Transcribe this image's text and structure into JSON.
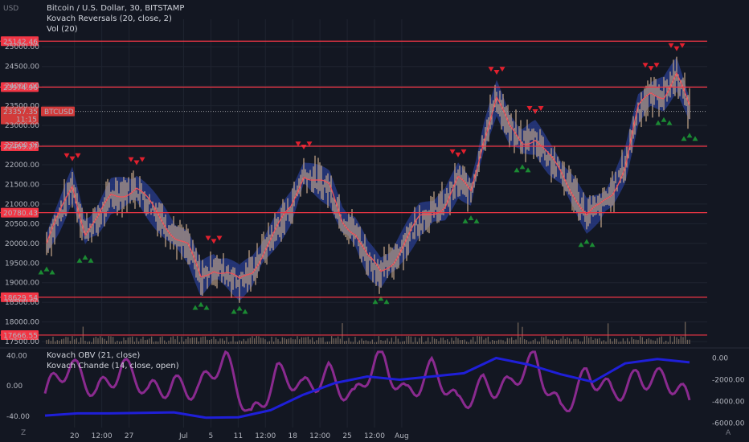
{
  "header": {
    "currency": "USD",
    "line1": "Bitcoin / U.S. Dollar, 30, BITSTAMP",
    "line2": "Kovach Reversals (20, close, 2)",
    "line3": "Vol (20)",
    "lower_line1": "Kovach OBV (21, close)",
    "lower_line2": "Kovach Chande (14, close, open)"
  },
  "price_tag": {
    "price": "23357.35",
    "countdown": "11:15",
    "symbol": "BTCUSD"
  },
  "corners": {
    "left": "Z",
    "right": "A"
  },
  "colors": {
    "background": "#131722",
    "level": "#f23645",
    "band": "#2a3e8f",
    "candle": "#c8a98a",
    "ma": "#e8545b",
    "up_marker": "#1b8a33",
    "down_marker": "#e1202e",
    "obv": "#1f1fd8",
    "chande": "#8a2a8f"
  },
  "chart_data": [
    {
      "type": "line",
      "title": "Bitcoin / U.S. Dollar, 30, BITSTAMP",
      "ylabel": "",
      "ylim": [
        17400,
        25700
      ],
      "y_ticks": [
        17500,
        18000,
        18500,
        19000,
        19500,
        20000,
        20500,
        21000,
        21500,
        22000,
        22500,
        23000,
        23500,
        24000,
        24500,
        25000
      ],
      "y_tick_labels": [
        "17500.00",
        "18000.00",
        "18500.00",
        "19000.00",
        "19500.00",
        "20000.00",
        "20500.00",
        "21000.00",
        "21500.00",
        "22000.00",
        "22500.00",
        "23000.00",
        "23500.00",
        "24000.00",
        "24500.00",
        "25000.00"
      ],
      "x_tick_labels": [
        "20",
        "12:00",
        "27",
        "Jul",
        "5",
        "11",
        "12:00",
        "18",
        "12:00",
        "25",
        "12:00",
        "Aug"
      ],
      "x_range_days": [
        19.4,
        31.6
      ],
      "x_tick_days": [
        20,
        20.5,
        21,
        22,
        22.5,
        23,
        23.5,
        24,
        24.5,
        25,
        25.5,
        26
      ],
      "x_tick_days_note": "",
      "levels": [
        {
          "value": 25142.46,
          "label": "25142.46"
        },
        {
          "value": 23974.96,
          "label": "23974.96"
        },
        {
          "value": 22469.27,
          "label": "22469.27"
        },
        {
          "value": 20780.43,
          "label": "20780.43"
        },
        {
          "value": 18629.54,
          "label": "18629.54"
        },
        {
          "value": 17666.55,
          "label": "17666.55"
        }
      ],
      "current_price": 23357.35,
      "series": [
        {
          "type": "line",
          "x": [
            0,
            0.02,
            0.04,
            0.06,
            0.08,
            0.1,
            0.12,
            0.14,
            0.16,
            0.18,
            0.2,
            0.22,
            0.24,
            0.26,
            0.28,
            0.3,
            0.32,
            0.34,
            0.36,
            0.38,
            0.4,
            0.42,
            0.44,
            0.46,
            0.48,
            0.5,
            0.52,
            0.54,
            0.56,
            0.58,
            0.6,
            0.62,
            0.64,
            0.66,
            0.68,
            0.7,
            0.72,
            0.74,
            0.76,
            0.78,
            0.8,
            0.82,
            0.84,
            0.86,
            0.88,
            0.9,
            0.92,
            0.94,
            0.96,
            0.98,
            1
          ],
          "values": [
            20000,
            20700,
            21500,
            20300,
            20600,
            21200,
            21300,
            21400,
            21000,
            20600,
            20200,
            19900,
            19100,
            19400,
            19250,
            19000,
            19300,
            19900,
            20400,
            20900,
            21800,
            21600,
            21400,
            20600,
            20300,
            19600,
            19250,
            19600,
            20100,
            20600,
            20800,
            21000,
            21600,
            21300,
            22700,
            23700,
            22900,
            22600,
            22700,
            22200,
            21800,
            21300,
            20700,
            20900,
            21300,
            22000,
            23400,
            23800,
            23800,
            24300,
            23400
          ]
        }
      ]
    },
    {
      "type": "line",
      "title": "Kovach OBV (21, close)",
      "ylim": [
        -6400,
        700
      ],
      "y_ticks": [
        0,
        -2000,
        -4000,
        -6000
      ],
      "y_tick_labels": [
        "0.00",
        "-2000.00",
        "-4000.00",
        "-6000.00"
      ],
      "series": [
        {
          "name": "Kovach OBV (21, close)",
          "x": [
            0,
            0.05,
            0.1,
            0.15,
            0.2,
            0.25,
            0.3,
            0.35,
            0.4,
            0.45,
            0.5,
            0.55,
            0.6,
            0.65,
            0.7,
            0.75,
            0.8,
            0.85,
            0.9,
            0.95,
            1
          ],
          "values": [
            -5300,
            -5100,
            -5100,
            -5050,
            -5000,
            -5500,
            -5450,
            -4800,
            -3400,
            -2300,
            -1700,
            -2000,
            -1700,
            -1400,
            0,
            -600,
            -1500,
            -2200,
            -500,
            -100,
            -400
          ]
        },
        {
          "name": "Kovach Chande (14, close, open)",
          "axis": "left",
          "ylim": [
            -55,
            47
          ],
          "y_ticks": [
            40,
            0,
            -40
          ],
          "y_tick_labels": [
            "40.00",
            "0.00",
            "-40.00"
          ],
          "x": [
            0,
            0.04,
            0.08,
            0.12,
            0.16,
            0.2,
            0.24,
            0.28,
            0.32,
            0.36,
            0.4,
            0.44,
            0.48,
            0.52,
            0.56,
            0.6,
            0.64,
            0.68,
            0.72,
            0.76,
            0.8,
            0.84,
            0.88,
            0.92,
            0.96,
            1
          ],
          "values": [
            -10,
            20,
            0,
            25,
            -15,
            10,
            -5,
            30,
            -35,
            15,
            -10,
            25,
            -20,
            35,
            -5,
            20,
            -30,
            10,
            -5,
            30,
            -25,
            10,
            -15,
            20,
            5,
            -25
          ]
        }
      ]
    }
  ]
}
